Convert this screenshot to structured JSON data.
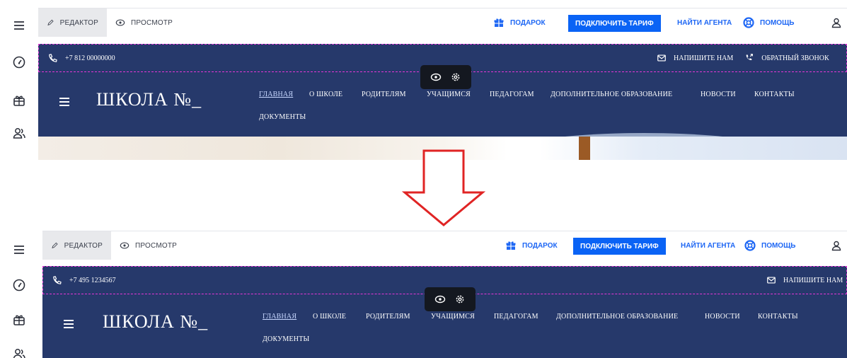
{
  "topbar": {
    "tab_editor": "Редактор",
    "tab_preview": "Просмотр",
    "gift_label": "Подарок",
    "cta_label": "Подключить тариф",
    "agent_label": "Найти агента",
    "help_label": "Помощь"
  },
  "before": {
    "phone": "+7 812 00000000",
    "write_us": "НАПИШИТЕ НАМ",
    "callback": "ОБРАТНЫЙ ЗВОНОК"
  },
  "after": {
    "phone": "+7 495 1234567",
    "write_us": "НАПИШИТЕ НАМ"
  },
  "site": {
    "logo": "ШКОЛА №_",
    "nav": [
      "ГЛАВНАЯ",
      "О ШКОЛЕ",
      "РОДИТЕЛЯМ",
      "УЧАЩИМСЯ",
      "ПЕДАГОГАМ",
      "ДОПОЛНИТЕЛЬНОЕ ОБРАЗОВАНИЕ",
      "НОВОСТИ",
      "КОНТАКТЫ",
      "ДОКУМЕНТЫ"
    ]
  },
  "colors": {
    "header_bg": "#26396b",
    "accent_blue": "#0a63f5",
    "link_blue": "#1e67f4",
    "selection_outline": "#e535d6",
    "arrow": "#e02424"
  }
}
